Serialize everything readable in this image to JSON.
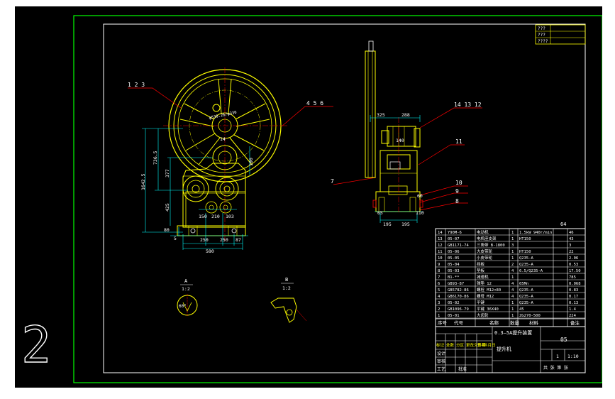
{
  "colors": {
    "background": "#000000",
    "frame": "#00ff00",
    "geometry": "#ffff00",
    "dimension": "#00ffff",
    "leader": "#ff0000",
    "white": "#ffffff",
    "green_text": "#00ff00",
    "page": "#ffffff"
  },
  "sheet_number": "2",
  "revision_block": [
    "???",
    "???",
    "????"
  ],
  "callouts": {
    "c123": "1  2  3",
    "c456": "4  5  6",
    "c141312": "14 13 12",
    "c11": "11",
    "c7": "7",
    "c10": "10",
    "c9": "9",
    "c8": "8"
  },
  "front_dims": {
    "d1642": "1642.5",
    "d736": "736.5",
    "d377": "377",
    "d425": "425",
    "d80": "80",
    "d5": "5",
    "d150": "150",
    "d210": "210",
    "d103": "103",
    "d250a": "250",
    "d250b": "250",
    "d87": "87",
    "d580": "580",
    "d100": "100",
    "d14": "14",
    "pitch": "φ530.26/φ330"
  },
  "side_dims": {
    "d325": "325",
    "d288": "288",
    "d140": "140",
    "d60": "60",
    "d65": "65",
    "d110": "110",
    "d195a": "195",
    "d195b": "195"
  },
  "details": {
    "a_letter": "A",
    "a_scale": "1:2",
    "a_angle": "60°",
    "b_letter": "B",
    "b_scale": "1:2"
  },
  "bom_top_value": "64",
  "bom_rows": [
    [
      "14",
      "Y90M-6",
      "电动机",
      "1",
      "1.5kW 940r/min",
      "46"
    ],
    [
      "13",
      "05-07",
      "电机座支架",
      "1",
      "HT150",
      "43"
    ],
    [
      "12",
      "GB1171-74",
      "三角带 B-1800",
      "3",
      "",
      "3"
    ],
    [
      "11",
      "05-06",
      "大皮带轮",
      "1",
      "HT150",
      "22"
    ],
    [
      "10",
      "05-05",
      "小皮带轮",
      "1",
      "Q235-A",
      "2.06"
    ],
    [
      "9",
      "05-04",
      "挡板",
      "2",
      "Q235-A",
      "0.53"
    ],
    [
      "8",
      "05-03",
      "垫板",
      "4",
      "6.5/Q235-A",
      "17.50"
    ],
    [
      "7",
      "B1-**",
      "减速机",
      "1",
      "",
      "785"
    ],
    [
      "6",
      "GB93-87",
      "弹垫 12",
      "4",
      "65Mn",
      "0.068"
    ],
    [
      "5",
      "GB5782-86",
      "螺栓 M12×80",
      "4",
      "Q235-A",
      "0.83"
    ],
    [
      "4",
      "GB6170-86",
      "螺母 M12",
      "4",
      "Q235-A",
      "0.17"
    ],
    [
      "3",
      "05-02",
      "平键",
      "1",
      "Q235-A",
      "0.13"
    ],
    [
      "2",
      "GB1096-79",
      "平键 36X40",
      "1",
      "45",
      "1.4"
    ],
    [
      "1",
      "05-01",
      "大齿轮",
      "1",
      "ZG270-500",
      "224"
    ]
  ],
  "bom_header": [
    "序号",
    "代号",
    "名称",
    "数量",
    "材料",
    "备注"
  ],
  "title_block": {
    "drawing_title": "0.3—5A提升装置",
    "code": "05",
    "project": "提升机",
    "quantity": "1",
    "scale": "1:10",
    "sheet_info": "共 张 第 张",
    "labels": [
      "标记",
      "处数",
      "分区",
      "更改文件号",
      "签名",
      "年月日"
    ],
    "roles": [
      "设计",
      "审核",
      "工艺",
      "批准"
    ]
  }
}
